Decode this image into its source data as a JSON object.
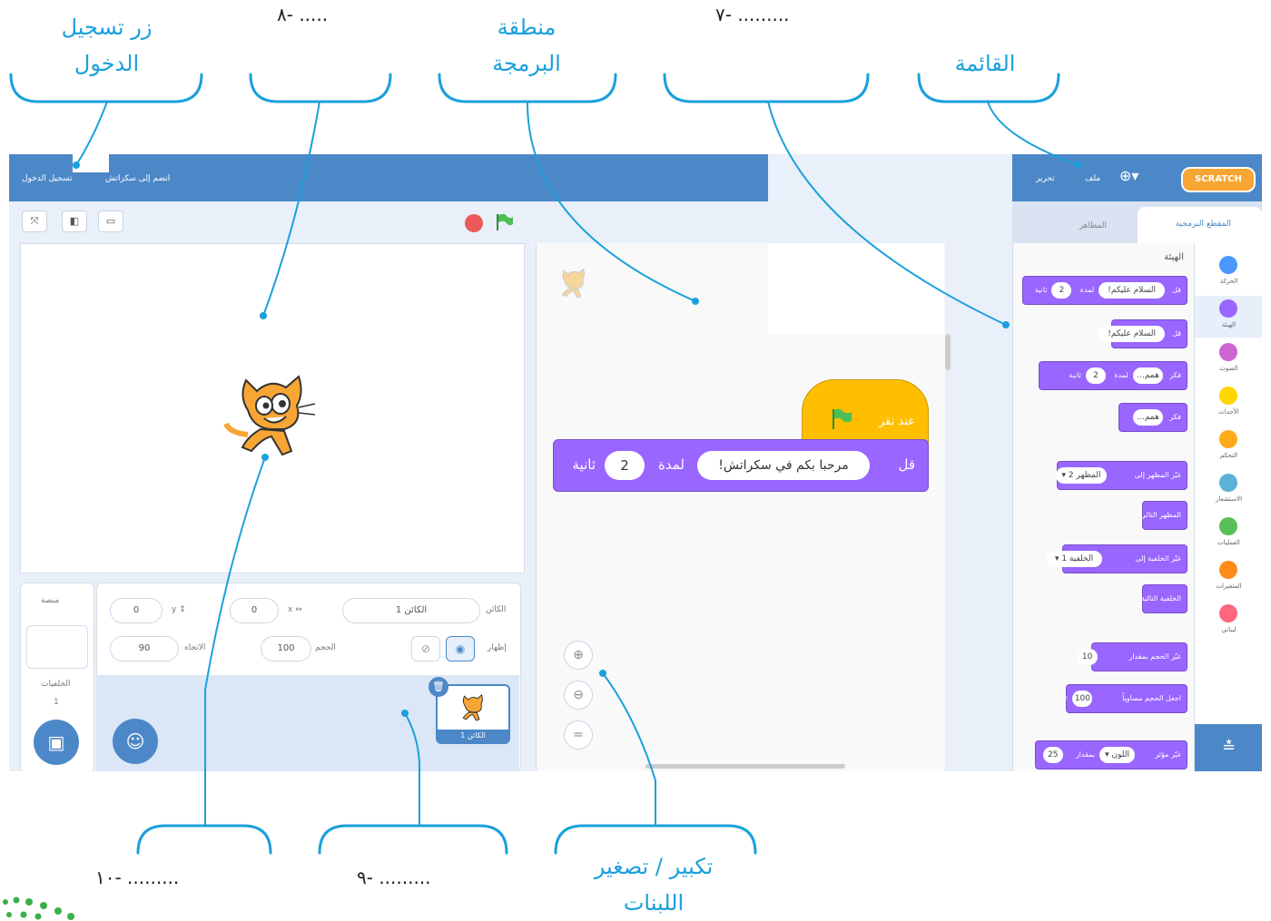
{
  "annotations": {
    "login_button": "زر تسجيل\nالدخول",
    "blank_8": "..... -٨",
    "coding_area": "منطقة\nالبرمجة",
    "blank_7": "......... -٧",
    "menu": "القائمة",
    "blank_10": "......... -١٠",
    "blank_9": "......... -٩",
    "zoom_blocks": "تكبير / تصغير\nاللبنات"
  },
  "scratch": {
    "topbar_left": {
      "join": "انضم إلى سكراتش",
      "signin": "تسجيل الدخول"
    },
    "topbar_right": {
      "logo": "SCRATCH",
      "file": "ملف",
      "edit": "تحرير"
    },
    "tabs": {
      "code": "المقطع البرمجية",
      "costumes": "المظاهر"
    },
    "palette_heading": "الهيئة",
    "categories": [
      {
        "label": "الحركة",
        "color": "#4c97ff"
      },
      {
        "label": "الهيئة",
        "color": "#9966ff"
      },
      {
        "label": "الصوت",
        "color": "#cf63cf"
      },
      {
        "label": "الأحداث",
        "color": "#ffd500"
      },
      {
        "label": "التحكم",
        "color": "#ffab19"
      },
      {
        "label": "الاستشعار",
        "color": "#5cb1d6"
      },
      {
        "label": "العمليات",
        "color": "#59c059"
      },
      {
        "label": "المتغيرات",
        "color": "#ff8c1a"
      },
      {
        "label": "لبناتي",
        "color": "#ff6680"
      }
    ],
    "palette_blocks": [
      {
        "label": "قل",
        "pill1": "السلام عليكم!",
        "mid": "لمدة",
        "pill2": "2",
        "tail": "ثانية"
      },
      {
        "label": "قل",
        "pill1": "السلام عليكم!"
      },
      {
        "label": "فكر",
        "pill1": "همم...",
        "mid": "لمدة",
        "pill2": "2",
        "tail": "ثانية"
      },
      {
        "label": "فكر",
        "pill1": "همم..."
      },
      {
        "label": "غيّر المظهر إلى",
        "pill1": "المظهر 2 ▾"
      },
      {
        "label": "المظهر التالي"
      },
      {
        "label": "غيّر الخلفية إلى",
        "pill1": "الخلفية 1 ▾"
      },
      {
        "label": "الخلفية التالية"
      },
      {
        "label": "غيّر الحجم بمقدار",
        "pill1": "10"
      },
      {
        "label": "اجعل الحجم مساوياً",
        "pill1": "100",
        "tail": "٪"
      },
      {
        "label": "غيّر مؤثر",
        "pill1": "اللون ▾",
        "mid": "بمقدار",
        "pill2": "25"
      }
    ],
    "script": {
      "hat": "عند نقر",
      "say_label": "قل",
      "say_text": "مرحبا بكم في سكراتش!",
      "duration_label": "لمدة",
      "duration_value": "2",
      "seconds_label": "ثانية"
    },
    "sprite_info": {
      "sprite_label": "الكائن",
      "sprite_name": "الكائن 1",
      "x_label": "x",
      "x_value": "0",
      "y_label": "y",
      "y_value": "0",
      "show_label": "إظهار",
      "size_label": "الحجم",
      "size_value": "100",
      "direction_label": "الاتجاه",
      "direction_value": "90"
    },
    "stage_pane": {
      "title": "منصة",
      "backdrops_label": "الخلفيات",
      "backdrops_count": "1"
    },
    "sprite_thumb_label": "الكائن 1"
  },
  "colors": {
    "annotation_blue": "#1aa0dc",
    "menubar": "#4c88c8",
    "looks": "#9966ff",
    "events": "#ffbf00",
    "green_flag": "#4cbf56",
    "stop": "#ec5959"
  }
}
